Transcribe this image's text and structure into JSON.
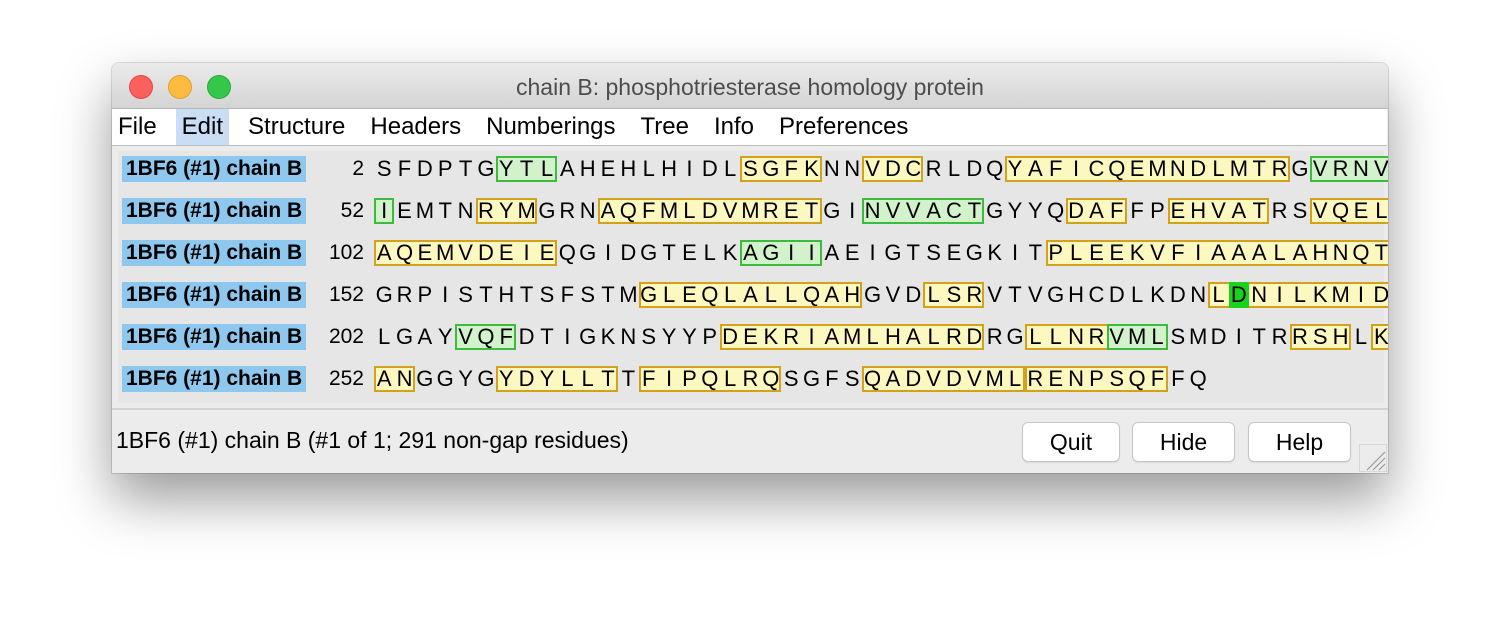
{
  "window": {
    "title": "chain B: phosphotriesterase homology protein"
  },
  "menu": [
    {
      "label": "File",
      "active": false
    },
    {
      "label": "Edit",
      "active": true
    },
    {
      "label": "Structure",
      "active": false
    },
    {
      "label": "Headers",
      "active": false
    },
    {
      "label": "Numberings",
      "active": false
    },
    {
      "label": "Tree",
      "active": false
    },
    {
      "label": "Info",
      "active": false
    },
    {
      "label": "Preferences",
      "active": false
    }
  ],
  "sequence_rows": [
    {
      "label": "1BF6 (#1) chain B",
      "start": "2",
      "sequence": "SFDPTGYTLAHEHLHIDLSGFKNNVDCRLDQYAFICQEMNDLMTRGVRNV",
      "highlights": [
        {
          "type": "strand",
          "start": 6,
          "end": 8
        },
        {
          "type": "helix",
          "start": 18,
          "end": 21
        },
        {
          "type": "helix",
          "start": 24,
          "end": 26
        },
        {
          "type": "helix",
          "start": 31,
          "end": 44
        },
        {
          "type": "strand",
          "start": 46,
          "end": 49
        }
      ]
    },
    {
      "label": "1BF6 (#1) chain B",
      "start": "52",
      "sequence": "IEMTNRYMGRNAQFMLDVMRETGINVVACTGYYQDAFFPEHVATRSVQEL",
      "highlights": [
        {
          "type": "strand",
          "start": 0,
          "end": 0
        },
        {
          "type": "helix",
          "start": 5,
          "end": 7
        },
        {
          "type": "helix",
          "start": 11,
          "end": 21
        },
        {
          "type": "strand",
          "start": 24,
          "end": 29
        },
        {
          "type": "helix",
          "start": 34,
          "end": 36
        },
        {
          "type": "helix",
          "start": 39,
          "end": 43
        },
        {
          "type": "helix",
          "start": 46,
          "end": 49
        }
      ]
    },
    {
      "label": "1BF6 (#1) chain B",
      "start": "102",
      "sequence": "AQEMVDEIEQGIDGTELKAGIIAEIGTSEGKITPLEEKVFIAAALAHNQT",
      "highlights": [
        {
          "type": "helix",
          "start": 0,
          "end": 8
        },
        {
          "type": "strand",
          "start": 18,
          "end": 21
        },
        {
          "type": "helix",
          "start": 33,
          "end": 49
        }
      ]
    },
    {
      "label": "1BF6 (#1) chain B",
      "start": "152",
      "sequence": "GRPISTHTSFSTMGLEQLALLQAHGVDLSRVTVGHCDLKDNLDNILKMID",
      "highlights": [
        {
          "type": "helix",
          "start": 13,
          "end": 23
        },
        {
          "type": "helix",
          "start": 27,
          "end": 29
        },
        {
          "type": "helix",
          "start": 41,
          "end": 49
        },
        {
          "type": "solid",
          "start": 42,
          "end": 42
        }
      ]
    },
    {
      "label": "1BF6 (#1) chain B",
      "start": "202",
      "sequence": "LGAYVQFDTIGKNSYYPDEKRIAMLHALRDRGLLNRVMLSMDITRRSHLK",
      "highlights": [
        {
          "type": "strand",
          "start": 4,
          "end": 6
        },
        {
          "type": "helix",
          "start": 17,
          "end": 29
        },
        {
          "type": "helix",
          "start": 32,
          "end": 38
        },
        {
          "type": "strand",
          "start": 36,
          "end": 38
        },
        {
          "type": "helix",
          "start": 45,
          "end": 47
        },
        {
          "type": "helix",
          "start": 49,
          "end": 49
        }
      ]
    },
    {
      "label": "1BF6 (#1) chain B",
      "start": "252",
      "sequence": "ANGGYGYDYLLTTFIPQLRQSGFSQADVDVMLRENPSQFFQ",
      "highlights": [
        {
          "type": "helix",
          "start": 0,
          "end": 1
        },
        {
          "type": "helix",
          "start": 6,
          "end": 11
        },
        {
          "type": "helix",
          "start": 13,
          "end": 19
        },
        {
          "type": "helix",
          "start": 24,
          "end": 31
        },
        {
          "type": "helix",
          "start": 32,
          "end": 38
        }
      ]
    }
  ],
  "status": {
    "text": "1BF6 (#1) chain B (#1 of 1; 291 non-gap residues)"
  },
  "buttons": {
    "quit": "Quit",
    "hide": "Hide",
    "help": "Help"
  },
  "colors": {
    "label_bg": "#8ec8ee",
    "helix_fill": "#fdf8c0",
    "helix_border": "#d4a11c",
    "strand_fill": "#d2f2cb",
    "strand_border": "#3dbb3d",
    "highlight_solid": "#19d21b",
    "menu_active": "#c9ddf5"
  },
  "icons": {
    "close": "close-icon",
    "minimize": "minimize-icon",
    "zoom": "zoom-icon",
    "resize": "resize-grip-icon"
  }
}
